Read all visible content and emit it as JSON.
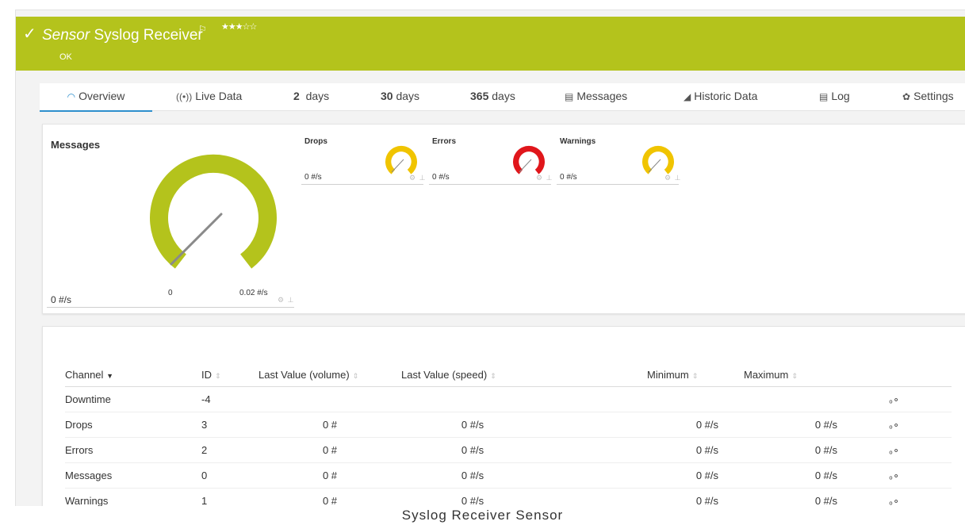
{
  "header": {
    "title_type": "Sensor",
    "title_name": "Syslog Receiver",
    "status": "OK",
    "flag_icon": "flag-icon",
    "rating": 3,
    "rating_max": 5,
    "rating_stars": "★★★☆☆",
    "color": "#b4c31c"
  },
  "tabs": [
    {
      "icon": "overview-gauge-icon",
      "label": "Overview",
      "active": true
    },
    {
      "icon": "live-data-icon",
      "label": "Live Data"
    },
    {
      "number": "2",
      "label": "days"
    },
    {
      "number": "30",
      "label": "days"
    },
    {
      "number": "365",
      "label": "days"
    },
    {
      "icon": "messages-icon",
      "label": "Messages"
    },
    {
      "icon": "historic-data-icon",
      "label": "Historic Data"
    },
    {
      "icon": "log-icon",
      "label": "Log"
    },
    {
      "icon": "gear-icon",
      "label": "Settings"
    }
  ],
  "gauges": {
    "messages": {
      "title": "Messages",
      "value": "0 #/s",
      "min": "0",
      "max": "0.02 #/s",
      "color": "#b4c31c"
    },
    "drops": {
      "title": "Drops",
      "value": "0 #/s",
      "color": "#f0c400"
    },
    "errors": {
      "title": "Errors",
      "value": "0 #/s",
      "color": "#e0161b"
    },
    "warnings": {
      "title": "Warnings",
      "value": "0 #/s",
      "color": "#f0c400"
    }
  },
  "table": {
    "headers": [
      "Channel",
      "ID",
      "Last Value (volume)",
      "Last Value (speed)",
      "Minimum",
      "Maximum"
    ],
    "rows": [
      {
        "channel": "Downtime",
        "id": "-4",
        "volume": "",
        "speed": "",
        "min": "",
        "max": ""
      },
      {
        "channel": "Drops",
        "id": "3",
        "volume": "0 #",
        "speed": "0 #/s",
        "min": "0 #/s",
        "max": "0 #/s"
      },
      {
        "channel": "Errors",
        "id": "2",
        "volume": "0 #",
        "speed": "0 #/s",
        "min": "0 #/s",
        "max": "0 #/s"
      },
      {
        "channel": "Messages",
        "id": "0",
        "volume": "0 #",
        "speed": "0 #/s",
        "min": "0 #/s",
        "max": "0 #/s"
      },
      {
        "channel": "Warnings",
        "id": "1",
        "volume": "0 #",
        "speed": "0 #/s",
        "min": "0 #/s",
        "max": "0 #/s"
      }
    ]
  },
  "caption": "Syslog Receiver Sensor"
}
